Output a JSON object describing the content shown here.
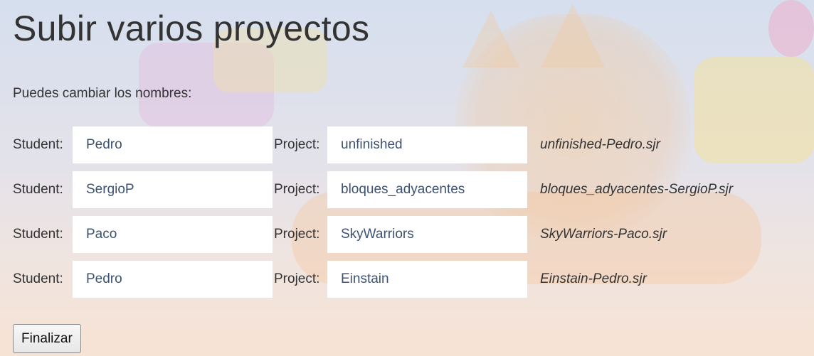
{
  "page": {
    "title": "Subir varios proyectos",
    "intro": "Puedes cambiar los nombres:"
  },
  "labels": {
    "student": "Student:",
    "project": "Project:"
  },
  "rows": [
    {
      "student": "Pedro",
      "project": "unfinished",
      "filename": "unfinished-Pedro.sjr"
    },
    {
      "student": "SergioP",
      "project": "bloques_adyacentes",
      "filename": "bloques_adyacentes-SergioP.sjr"
    },
    {
      "student": "Paco",
      "project": "SkyWarriors",
      "filename": "SkyWarriors-Paco.sjr"
    },
    {
      "student": "Pedro",
      "project": "Einstain",
      "filename": "Einstain-Pedro.sjr"
    }
  ],
  "actions": {
    "finish_label": "Finalizar"
  },
  "colors": {
    "text": "#333333",
    "input_text": "#3d5270",
    "input_bg": "#ffffff"
  }
}
